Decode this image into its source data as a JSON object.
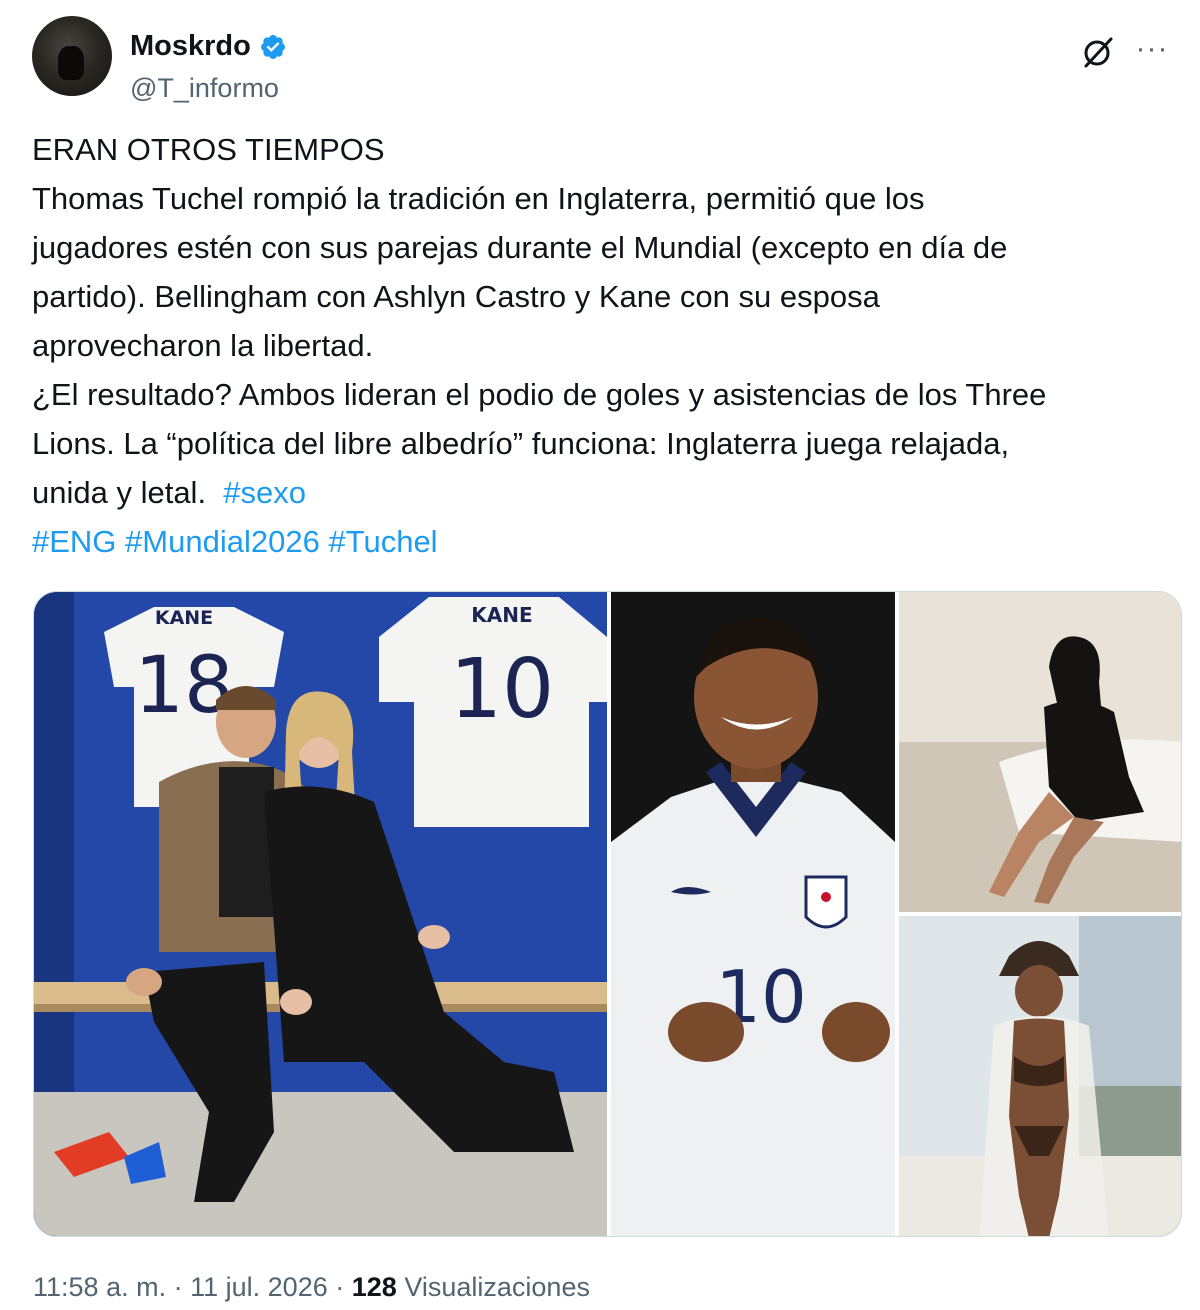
{
  "author": {
    "display_name": "Moskrdo",
    "handle": "@T_informo",
    "verified": true
  },
  "icons": {
    "verified": "verified-badge-icon",
    "grok": "grok-icon",
    "more": "more-icon"
  },
  "tweet": {
    "lines": [
      "ERAN OTROS TIEMPOS",
      "Thomas Tuchel rompió la tradición en Inglaterra, permitió que los",
      "jugadores estén con sus parejas durante el Mundial (excepto en día de",
      "partido).  Bellingham con Ashlyn Castro y Kane con su esposa",
      "aprovecharon la libertad.",
      "¿El resultado? Ambos lideran el podio de goles y asistencias de los Three",
      "Lions. La “política del libre albedrío” funciona: Inglaterra juega relajada,",
      "unida y letal."
    ],
    "inline_hashtag": "#sexo",
    "hashtags": [
      "#ENG",
      "#Mundial2026",
      "#Tuchel"
    ]
  },
  "media": {
    "photo1": {
      "shirt_left_name": "KANE",
      "shirt_left_number": "18",
      "shirt_right_name": "KANE",
      "shirt_right_number": "10"
    },
    "photo2": {
      "shirt_number": "10"
    }
  },
  "meta": {
    "time": "11:58 a. m.",
    "separator": "·",
    "date": "11 jul. 2026",
    "views_count": "128",
    "views_label": "Visualizaciones"
  },
  "colors": {
    "text": "#0f1419",
    "secondary": "#536471",
    "link": "#1d9bf0",
    "verified": "#1d9bf0",
    "border": "#cfd9de"
  }
}
